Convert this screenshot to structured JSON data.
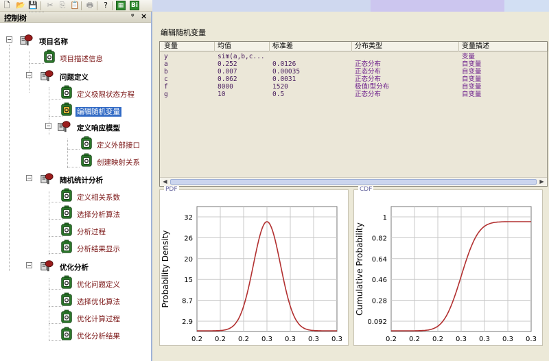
{
  "toolbar": {
    "buttons": [
      {
        "name": "new-file-icon",
        "glyph": "🗋",
        "dim": false
      },
      {
        "name": "open-folder-icon",
        "glyph": "📂",
        "dim": false
      },
      {
        "name": "save-icon",
        "glyph": "💾",
        "dim": false
      },
      {
        "name": "cut-icon",
        "glyph": "✂",
        "dim": true
      },
      {
        "name": "copy-icon",
        "glyph": "⎘",
        "dim": true
      },
      {
        "name": "paste-icon",
        "glyph": "📋",
        "dim": true
      },
      {
        "name": "print-icon",
        "glyph": "🖶",
        "dim": true
      },
      {
        "name": "help-icon",
        "glyph": "?",
        "dim": false
      },
      {
        "name": "green-grid-icon",
        "glyph": "▦",
        "dim": false
      },
      {
        "name": "green-bi-icon",
        "glyph": "Bi",
        "dim": false
      }
    ]
  },
  "tree_panel": {
    "title": "控制树",
    "pin_glyph": "ᵠ",
    "close_glyph": "×"
  },
  "tree": [
    {
      "label": "项目名称",
      "style": "bold",
      "icon": "server",
      "expander": "⊟"
    },
    {
      "label": "项目描述信息",
      "style": "leaf",
      "icon": "node"
    },
    {
      "label": "问题定义",
      "style": "bold",
      "icon": "server",
      "expander": "⊟"
    },
    {
      "label": "定义极限状态方程",
      "style": "leaf",
      "icon": "node"
    },
    {
      "label": "编辑随机变量",
      "style": "selected",
      "icon": "node-active"
    },
    {
      "label": "定义响应模型",
      "style": "bold",
      "icon": "server",
      "expander": "⊟"
    },
    {
      "label": "定义外部接口",
      "style": "leaf",
      "icon": "node"
    },
    {
      "label": "创建映射关系",
      "style": "leaf",
      "icon": "node"
    },
    {
      "label": "随机统计分析",
      "style": "bold",
      "icon": "server",
      "expander": "⊟"
    },
    {
      "label": "定义相关系数",
      "style": "leaf",
      "icon": "node"
    },
    {
      "label": "选择分析算法",
      "style": "leaf",
      "icon": "node"
    },
    {
      "label": "分析过程",
      "style": "leaf",
      "icon": "node"
    },
    {
      "label": "分析结果显示",
      "style": "leaf",
      "icon": "node"
    },
    {
      "label": "优化分析",
      "style": "bold",
      "icon": "server",
      "expander": "⊟"
    },
    {
      "label": "优化问题定义",
      "style": "leaf",
      "icon": "node"
    },
    {
      "label": "选择优化算法",
      "style": "leaf",
      "icon": "node"
    },
    {
      "label": "优化计算过程",
      "style": "leaf",
      "icon": "node"
    },
    {
      "label": "优化分析结果",
      "style": "leaf",
      "icon": "node"
    }
  ],
  "main": {
    "section_title": "编辑随机变量",
    "table": {
      "headers": [
        "变量",
        "均值",
        "标准差",
        "分布类型",
        "变量描述"
      ],
      "rows": [
        [
          "y",
          "sim(a,b,c...",
          "",
          "",
          "变量"
        ],
        [
          "a",
          "0.252",
          "0.0126",
          "正态分布",
          "自变量"
        ],
        [
          "b",
          "0.007",
          "0.00035",
          "正态分布",
          "自变量"
        ],
        [
          "c",
          "0.062",
          "0.0031",
          "正态分布",
          "自变量"
        ],
        [
          "f",
          "8000",
          "1520",
          "极值I型分布",
          "自变量"
        ],
        [
          "g",
          "10",
          "0.5",
          "正态分布",
          "自变量"
        ]
      ]
    },
    "hscroll": {
      "left_glyph": "◀",
      "right_glyph": "▶"
    }
  },
  "chart_data": [
    {
      "type": "line",
      "legend": "PDF",
      "ylabel": "Probability Density",
      "xlabel": "",
      "xticks": [
        "0.2",
        "0.2",
        "0.2",
        "0.3",
        "0.3",
        "0.3",
        "0.3"
      ],
      "yticks": [
        "2.9",
        "8.7",
        "15",
        "20",
        "26",
        "32"
      ],
      "xlim": [
        0.2,
        0.3
      ],
      "ylim": [
        0,
        35
      ],
      "grid": true,
      "line_color": "#b23030",
      "series": [
        {
          "curve": "normal",
          "mean": 0.252,
          "std": 0.0126,
          "peak": 31.7
        }
      ]
    },
    {
      "type": "line",
      "legend": "CDF",
      "ylabel": "Cumulative Probability",
      "xlabel": "",
      "xticks": [
        "0.2",
        "0.2",
        "0.2",
        "0.3",
        "0.3",
        "0.3",
        "0.3"
      ],
      "yticks": [
        "0.092",
        "0.28",
        "0.46",
        "0.64",
        "0.82",
        "1"
      ],
      "xlim": [
        0.2,
        0.3
      ],
      "ylim": [
        0,
        1.1
      ],
      "grid": true,
      "line_color": "#b23030",
      "series": [
        {
          "curve": "normal-cdf",
          "mean": 0.252,
          "std": 0.0126,
          "peak": 1.0
        }
      ]
    }
  ]
}
